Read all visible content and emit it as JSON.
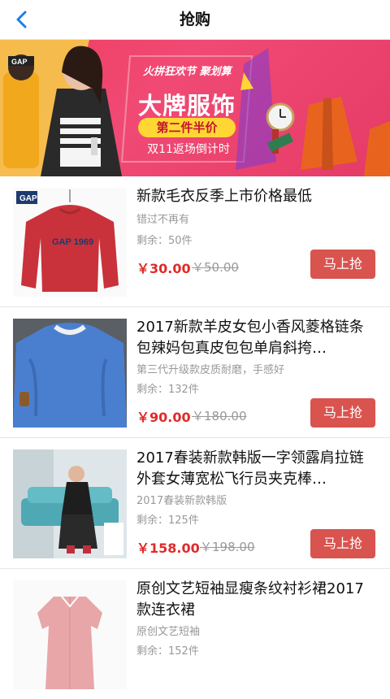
{
  "nav": {
    "title": "抢购",
    "back_icon": "chevron-left-icon"
  },
  "banner": {
    "tag": "火拼狂欢节 聚划算",
    "headline": "大牌服饰",
    "ribbon": "第二件半价",
    "subline": "双11返场倒计时",
    "brand_label": "GAP"
  },
  "products": [
    {
      "title": "新款毛衣反季上市价格最低",
      "subtitle": "错过不再有",
      "stock": "剩余：50件",
      "price": "￥30.00",
      "old_price": "￥50.00",
      "button": "马上抢",
      "thumb_text": "GAP 1969",
      "thumb_logo": "GAP"
    },
    {
      "title": "2017新款羊皮女包小香风菱格链条包辣妈包真皮包包单肩斜挎…",
      "subtitle": "第三代升级款皮质耐磨，手感好",
      "stock": "剩余：132件",
      "price": "￥90.00",
      "old_price": "￥180.00",
      "button": "马上抢"
    },
    {
      "title": "2017春装新款韩版一字领露肩拉链外套女薄宽松飞行员夹克棒…",
      "subtitle": "2017春装新款韩版",
      "stock": "剩余：125件",
      "price": "￥158.00",
      "old_price": "￥198.00",
      "button": "马上抢"
    },
    {
      "title": "原创文艺短袖显瘦条纹衬衫裙2017款连衣裙",
      "subtitle": "原创文艺短袖",
      "stock": "剩余：152件",
      "price": "",
      "old_price": "",
      "button": ""
    }
  ]
}
